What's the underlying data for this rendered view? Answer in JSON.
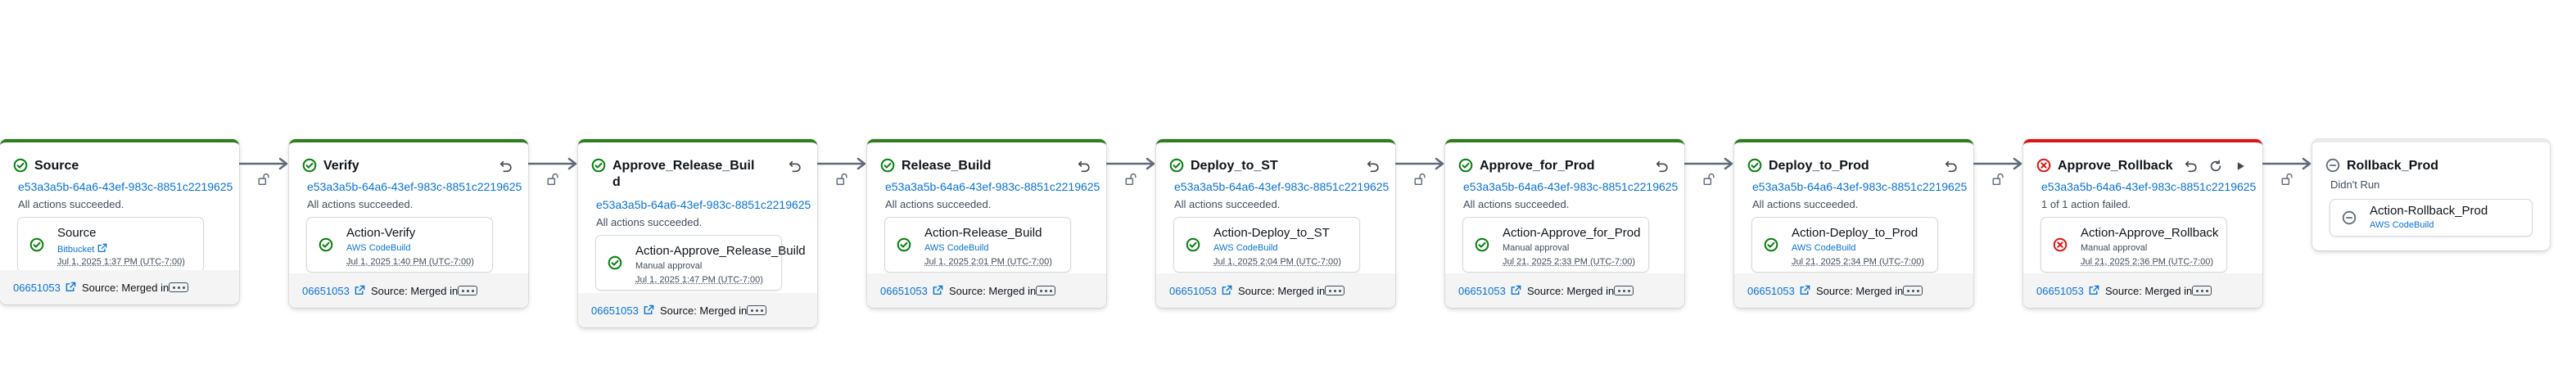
{
  "colors": {
    "success": "#037f0c",
    "error": "#d91515",
    "link": "#0972d3",
    "success_border": "#2e7d1e",
    "error_border": "#d91515"
  },
  "stages": [
    {
      "name": "Source",
      "status": "succeeded",
      "execution_id": "e53a3a5b-64a6-43ef-983c-8851c2219625",
      "message": "All actions succeeded.",
      "retry": false,
      "rerun": false,
      "play": false,
      "action": {
        "name": "Source",
        "provider": "Bitbucket",
        "provider_link": true,
        "time": "Jul 1, 2025 1:37 PM (UTC-7:00)",
        "status": "succeeded"
      },
      "commit": "06651053",
      "summary": "Source: Merged in"
    },
    {
      "name": "Verify",
      "status": "succeeded",
      "execution_id": "e53a3a5b-64a6-43ef-983c-8851c2219625",
      "message": "All actions succeeded.",
      "retry": true,
      "rerun": false,
      "play": false,
      "action": {
        "name": "Action-Verify",
        "provider": "AWS CodeBuild",
        "provider_link": false,
        "time": "Jul 1, 2025 1:40 PM (UTC-7:00)",
        "status": "succeeded"
      },
      "commit": "06651053",
      "summary": "Source: Merged in"
    },
    {
      "name": "Approve_Release_Buil\nd",
      "status": "succeeded",
      "execution_id": "e53a3a5b-64a6-43ef-983c-8851c2219625",
      "message": "All actions succeeded.",
      "retry": true,
      "rerun": false,
      "play": false,
      "action": {
        "name": "Action-Approve_Release_Build",
        "provider": "Manual approval",
        "provider_link": false,
        "time": "Jul 1, 2025 1:47 PM (UTC-7:00)",
        "status": "succeeded"
      },
      "commit": "06651053",
      "summary": "Source: Merged in"
    },
    {
      "name": "Release_Build",
      "status": "succeeded",
      "execution_id": "e53a3a5b-64a6-43ef-983c-8851c2219625",
      "message": "All actions succeeded.",
      "retry": true,
      "rerun": false,
      "play": false,
      "action": {
        "name": "Action-Release_Build",
        "provider": "AWS CodeBuild",
        "provider_link": false,
        "time": "Jul 1, 2025 2:01 PM (UTC-7:00)",
        "status": "succeeded"
      },
      "commit": "06651053",
      "summary": "Source: Merged in"
    },
    {
      "name": "Deploy_to_ST",
      "status": "succeeded",
      "execution_id": "e53a3a5b-64a6-43ef-983c-8851c2219625",
      "message": "All actions succeeded.",
      "retry": true,
      "rerun": false,
      "play": false,
      "action": {
        "name": "Action-Deploy_to_ST",
        "provider": "AWS CodeBuild",
        "provider_link": false,
        "time": "Jul 1, 2025 2:04 PM (UTC-7:00)",
        "status": "succeeded"
      },
      "commit": "06651053",
      "summary": "Source: Merged in"
    },
    {
      "name": "Approve_for_Prod",
      "status": "succeeded",
      "execution_id": "e53a3a5b-64a6-43ef-983c-8851c2219625",
      "message": "All actions succeeded.",
      "retry": true,
      "rerun": false,
      "play": false,
      "action": {
        "name": "Action-Approve_for_Prod",
        "provider": "Manual approval",
        "provider_link": false,
        "time": "Jul 21, 2025 2:33 PM (UTC-7:00)",
        "status": "succeeded"
      },
      "commit": "06651053",
      "summary": "Source: Merged in"
    },
    {
      "name": "Deploy_to_Prod",
      "status": "succeeded",
      "execution_id": "e53a3a5b-64a6-43ef-983c-8851c2219625",
      "message": "All actions succeeded.",
      "retry": true,
      "rerun": false,
      "play": false,
      "action": {
        "name": "Action-Deploy_to_Prod",
        "provider": "AWS CodeBuild",
        "provider_link": false,
        "time": "Jul 21, 2025 2:34 PM (UTC-7:00)",
        "status": "succeeded"
      },
      "commit": "06651053",
      "summary": "Source: Merged in"
    },
    {
      "name": "Approve_Rollback",
      "status": "failed",
      "execution_id": "e53a3a5b-64a6-43ef-983c-8851c2219625",
      "message": "1 of 1 action failed.",
      "retry": true,
      "rerun": true,
      "play": true,
      "action": {
        "name": "Action-Approve_Rollback",
        "provider": "Manual approval",
        "provider_link": false,
        "time": "Jul 21, 2025 2:36 PM (UTC-7:00)",
        "status": "failed"
      },
      "commit": "06651053",
      "summary": "Source: Merged in"
    },
    {
      "name": "Rollback_Prod",
      "status": "norun",
      "execution_id": "",
      "message": "Didn't Run",
      "retry": false,
      "rerun": false,
      "play": false,
      "action": {
        "name": "Action-Rollback_Prod",
        "provider": "AWS CodeBuild",
        "provider_link": false,
        "time": "",
        "status": "norun"
      },
      "commit": "",
      "summary": ""
    }
  ]
}
